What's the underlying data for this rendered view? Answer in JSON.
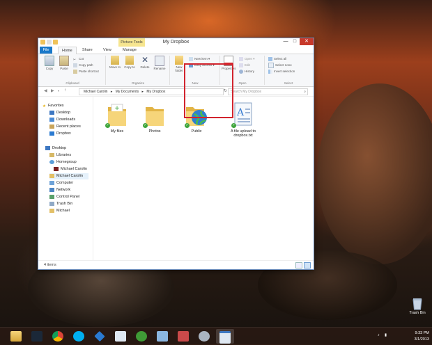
{
  "window": {
    "title": "My Dropbox",
    "context_tab": "Picture Tools",
    "controls": {
      "minimize": "—",
      "maximize": "□",
      "close": "✕"
    }
  },
  "ribbon": {
    "tabs": [
      "File",
      "Home",
      "Share",
      "View",
      "Manage"
    ],
    "clipboard": {
      "copy": "Copy",
      "paste": "Paste",
      "cut": "Cut",
      "copy_path": "Copy path",
      "paste_shortcut": "Paste shortcut",
      "label": "Clipboard"
    },
    "organize": {
      "move_to": "Move to",
      "copy_to": "Copy to",
      "delete": "Delete",
      "rename": "Rename",
      "label": "Organize"
    },
    "new": {
      "new_folder": "New folder",
      "new_item": "New item ▾",
      "easy_access": "Easy access ▾",
      "label": "New"
    },
    "open": {
      "properties": "Properties",
      "open": "Open ▾",
      "edit": "Edit",
      "history": "History",
      "label": "Open"
    },
    "select": {
      "select_all": "Select all",
      "select_none": "Select none",
      "invert": "Invert selection",
      "label": "Select"
    }
  },
  "address": {
    "segments": [
      "Michael Carolin",
      "▸",
      "My Documents",
      "▸",
      "My Dropbox"
    ],
    "search_placeholder": "Search My Dropbox"
  },
  "nav": {
    "favorites_header": "Favorites",
    "favorites": [
      "Desktop",
      "Downloads",
      "Recent places",
      "Dropbox"
    ],
    "tree": [
      "Desktop",
      "Libraries",
      "Homegroup",
      "Michael Carolin",
      "Michael Carolin",
      "Computer",
      "Network",
      "Control Panel",
      "Trash Bin",
      "Michael"
    ]
  },
  "files": [
    {
      "name": "My files"
    },
    {
      "name": "Photos"
    },
    {
      "name": "Public"
    },
    {
      "name": "A file upload to dropbox.txt"
    }
  ],
  "status": {
    "items": "4 items"
  },
  "desktop": {
    "trash_label": "Trash Bin"
  },
  "clock": {
    "time": "9:33 PM",
    "date": "3/1/2013"
  },
  "colors": {
    "accent": "#1979ca",
    "selection_border": "#d2242e",
    "folder": "#f0c35a",
    "check": "#3fa53d"
  }
}
